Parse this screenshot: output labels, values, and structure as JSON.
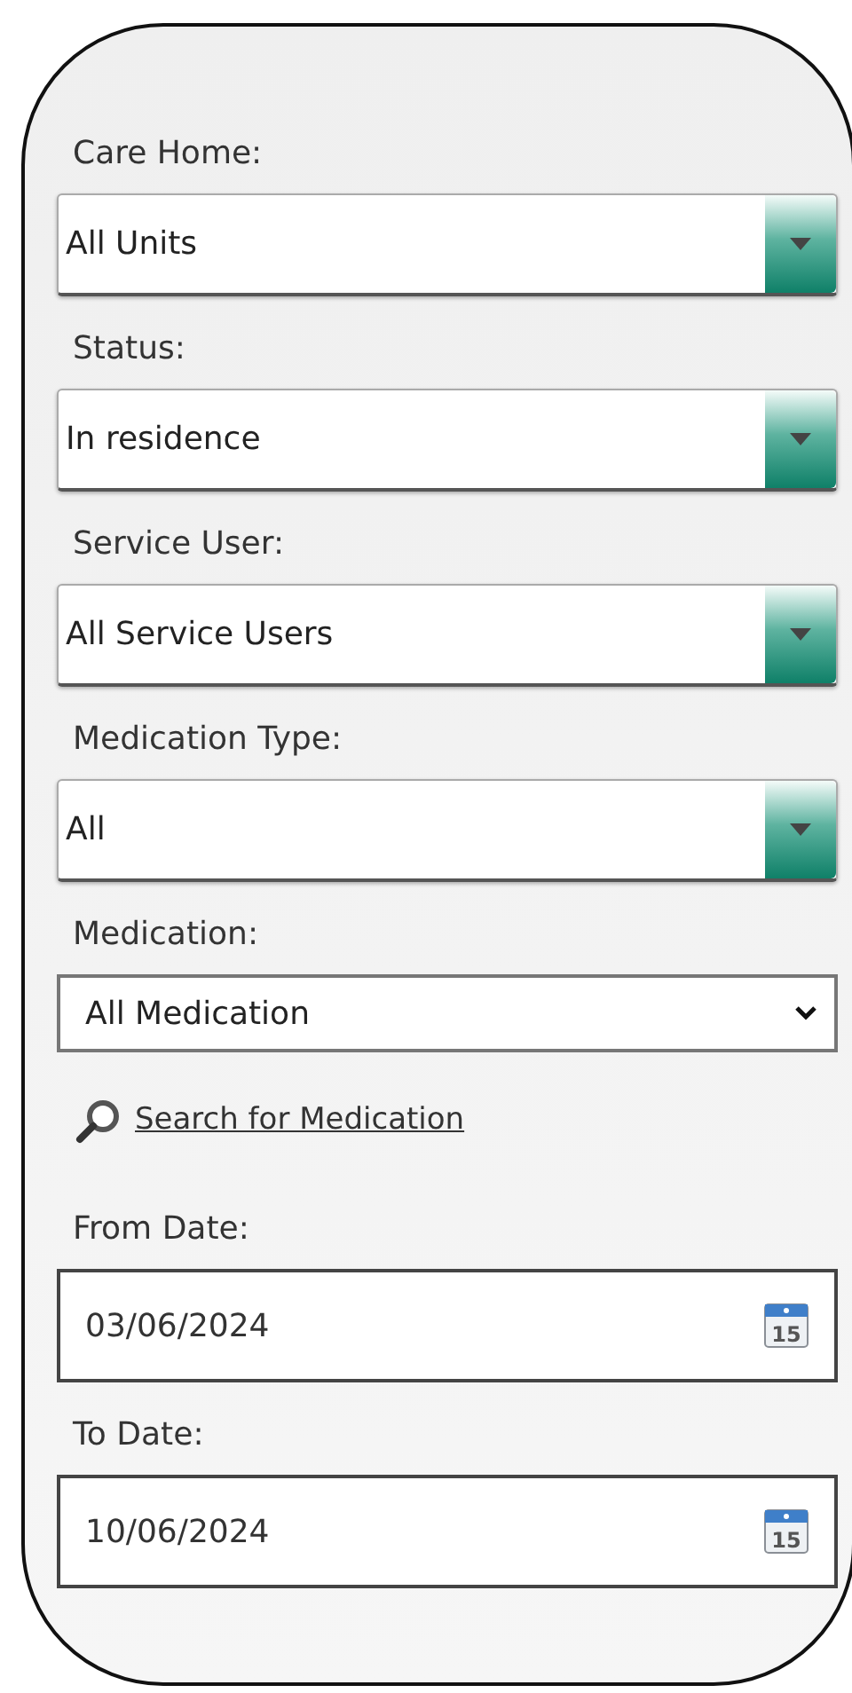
{
  "filters": [
    {
      "label": "Care Home:",
      "kind": "combo",
      "value": "All Units"
    },
    {
      "label": "Status:",
      "kind": "combo",
      "value": "In residence"
    },
    {
      "label": "Service User:",
      "kind": "combo",
      "value": "All Service Users"
    },
    {
      "label": "Medication Type:",
      "kind": "combo",
      "value": "All"
    },
    {
      "label": "Medication:",
      "kind": "select",
      "value": "All Medication"
    },
    {
      "kind": "link",
      "text": "Search for Medication"
    },
    {
      "label": "From Date:",
      "kind": "date",
      "value": "03/06/2024",
      "calendar_day": "15"
    },
    {
      "label": "To Date:",
      "kind": "date",
      "value": "10/06/2024",
      "calendar_day": "15"
    }
  ]
}
